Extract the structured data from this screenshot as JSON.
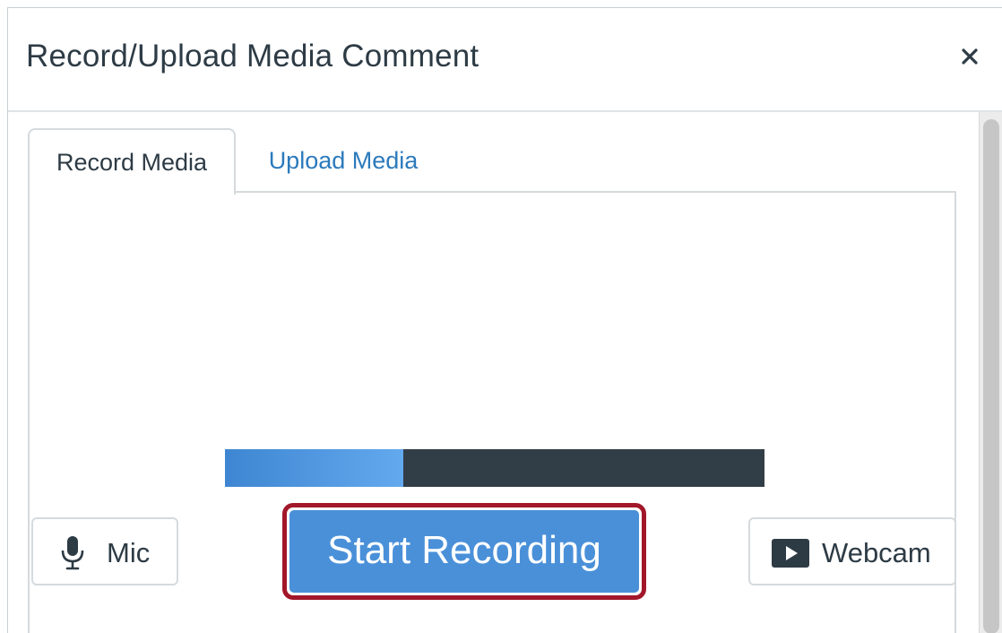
{
  "dialog": {
    "title": "Record/Upload Media Comment",
    "close_icon": "close-icon"
  },
  "tabs": [
    {
      "label": "Record Media",
      "active": true
    },
    {
      "label": "Upload Media",
      "active": false
    }
  ],
  "level_meter": {
    "level_fraction": 0.33,
    "fill_color": "#4a90d9",
    "track_color": "#323e47"
  },
  "buttons": {
    "mic": {
      "label": "Mic",
      "icon": "microphone-icon"
    },
    "start_recording": {
      "label": "Start Recording",
      "color": "#4a90d9",
      "highlight_color": "#a2172a"
    },
    "webcam": {
      "label": "Webcam",
      "icon": "video-camera-icon"
    }
  },
  "colors": {
    "link": "#2b7abc",
    "text": "#2d3b45"
  }
}
